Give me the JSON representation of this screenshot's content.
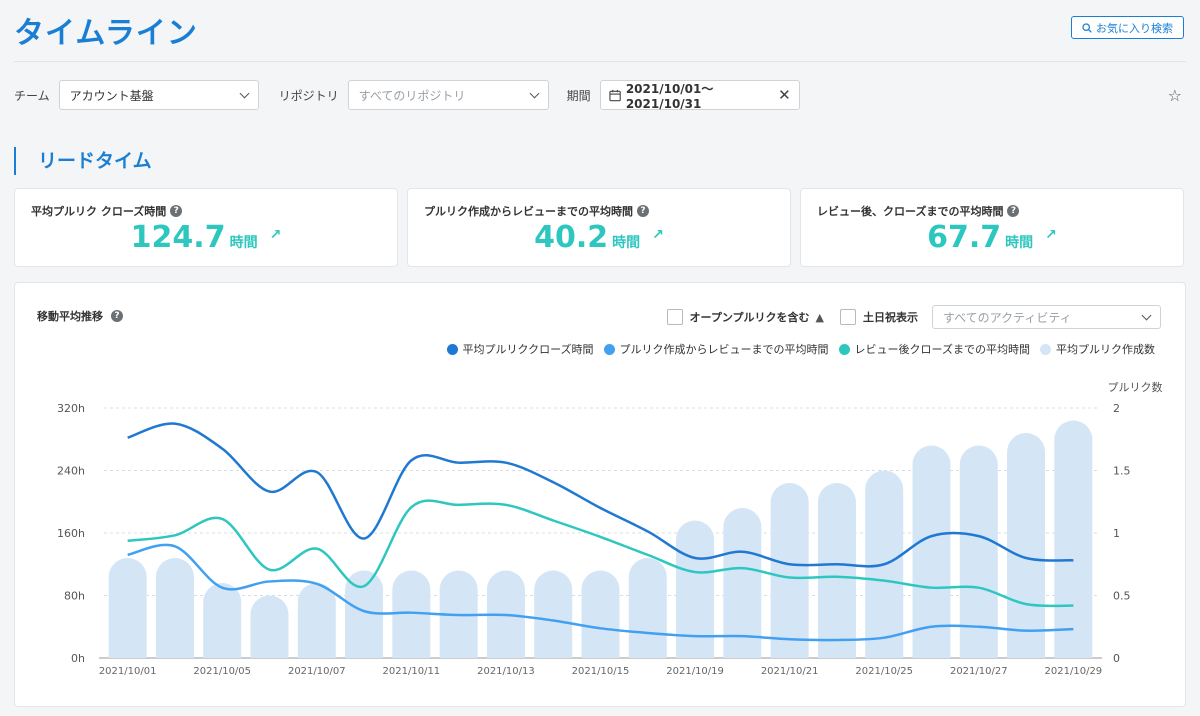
{
  "page": {
    "title": "タイムライン",
    "favorite_search_label": "お気に入り検索"
  },
  "filters": {
    "team_label": "チーム",
    "team_value": "アカウント基盤",
    "repo_label": "リポジトリ",
    "repo_placeholder": "すべてのリポジトリ",
    "period_label": "期間",
    "period_value": "2021/10/01〜2021/10/31"
  },
  "section": {
    "title": "リードタイム"
  },
  "kpis": [
    {
      "label": "平均プルリク クローズ時間",
      "value": "124.7",
      "unit": "時間"
    },
    {
      "label": "プルリク作成からレビューまでの平均時間",
      "value": "40.2",
      "unit": "時間"
    },
    {
      "label": "レビュー後、クローズまでの平均時間",
      "value": "67.7",
      "unit": "時間"
    }
  ],
  "chart_card": {
    "title": "移動平均推移",
    "open_pr_label": "オープンプルリクを含む",
    "holiday_label": "土日祝表示",
    "activity_placeholder": "すべてのアクティビティ"
  },
  "colors": {
    "accent": "#1a7fd4",
    "kpi_value": "#2ec7c0",
    "series1": "#1f78d1",
    "series2": "#42a0f0",
    "series3": "#2ec7c0",
    "bars": "#d4e5f6"
  },
  "icons": [
    "search-icon",
    "chevron-down-icon",
    "calendar-icon",
    "close-icon",
    "star-icon",
    "help-icon",
    "arrow-up-right-icon",
    "warning-icon"
  ],
  "chart_data": {
    "type": "line",
    "x": [
      "2021/10/01",
      "2021/10/04",
      "2021/10/05",
      "2021/10/06",
      "2021/10/07",
      "2021/10/08",
      "2021/10/11",
      "2021/10/12",
      "2021/10/13",
      "2021/10/14",
      "2021/10/15",
      "2021/10/18",
      "2021/10/19",
      "2021/10/20",
      "2021/10/21",
      "2021/10/22",
      "2021/10/25",
      "2021/10/26",
      "2021/10/27",
      "2021/10/28",
      "2021/10/29"
    ],
    "x_tick_labels": [
      "2021/10/01",
      "2021/10/05",
      "2021/10/07",
      "2021/10/11",
      "2021/10/13",
      "2021/10/15",
      "2021/10/19",
      "2021/10/21",
      "2021/10/25",
      "2021/10/27",
      "2021/10/29"
    ],
    "y_left": {
      "ticks": [
        "0h",
        "80h",
        "160h",
        "240h",
        "320h"
      ],
      "range": [
        0,
        320
      ]
    },
    "y_right": {
      "label": "プルリク数",
      "ticks": [
        "0",
        "0.5",
        "1",
        "1.5",
        "2"
      ],
      "range": [
        0,
        2
      ]
    },
    "series": [
      {
        "name": "平均プルリククローズ時間",
        "axis": "left",
        "values": [
          282,
          300,
          268,
          213,
          238,
          153,
          253,
          250,
          250,
          225,
          192,
          162,
          128,
          136,
          120,
          120,
          120,
          156,
          156,
          128,
          125
        ]
      },
      {
        "name": "プルリク作成からレビューまでの平均時間",
        "axis": "left",
        "values": [
          132,
          143,
          90,
          98,
          95,
          60,
          58,
          55,
          55,
          48,
          38,
          32,
          28,
          28,
          24,
          23,
          26,
          40,
          40,
          35,
          37
        ]
      },
      {
        "name": "レビュー後クローズまでの平均時間",
        "axis": "left",
        "values": [
          150,
          157,
          178,
          113,
          140,
          92,
          193,
          196,
          196,
          176,
          155,
          132,
          110,
          115,
          103,
          104,
          99,
          90,
          90,
          69,
          67
        ]
      },
      {
        "name": "平均プルリク作成数",
        "axis": "right",
        "type": "bar",
        "values": [
          0.8,
          0.8,
          0.6,
          0.5,
          0.6,
          0.7,
          0.7,
          0.7,
          0.7,
          0.7,
          0.7,
          0.8,
          1.1,
          1.2,
          1.4,
          1.4,
          1.5,
          1.7,
          1.7,
          1.8,
          1.9
        ]
      }
    ]
  }
}
